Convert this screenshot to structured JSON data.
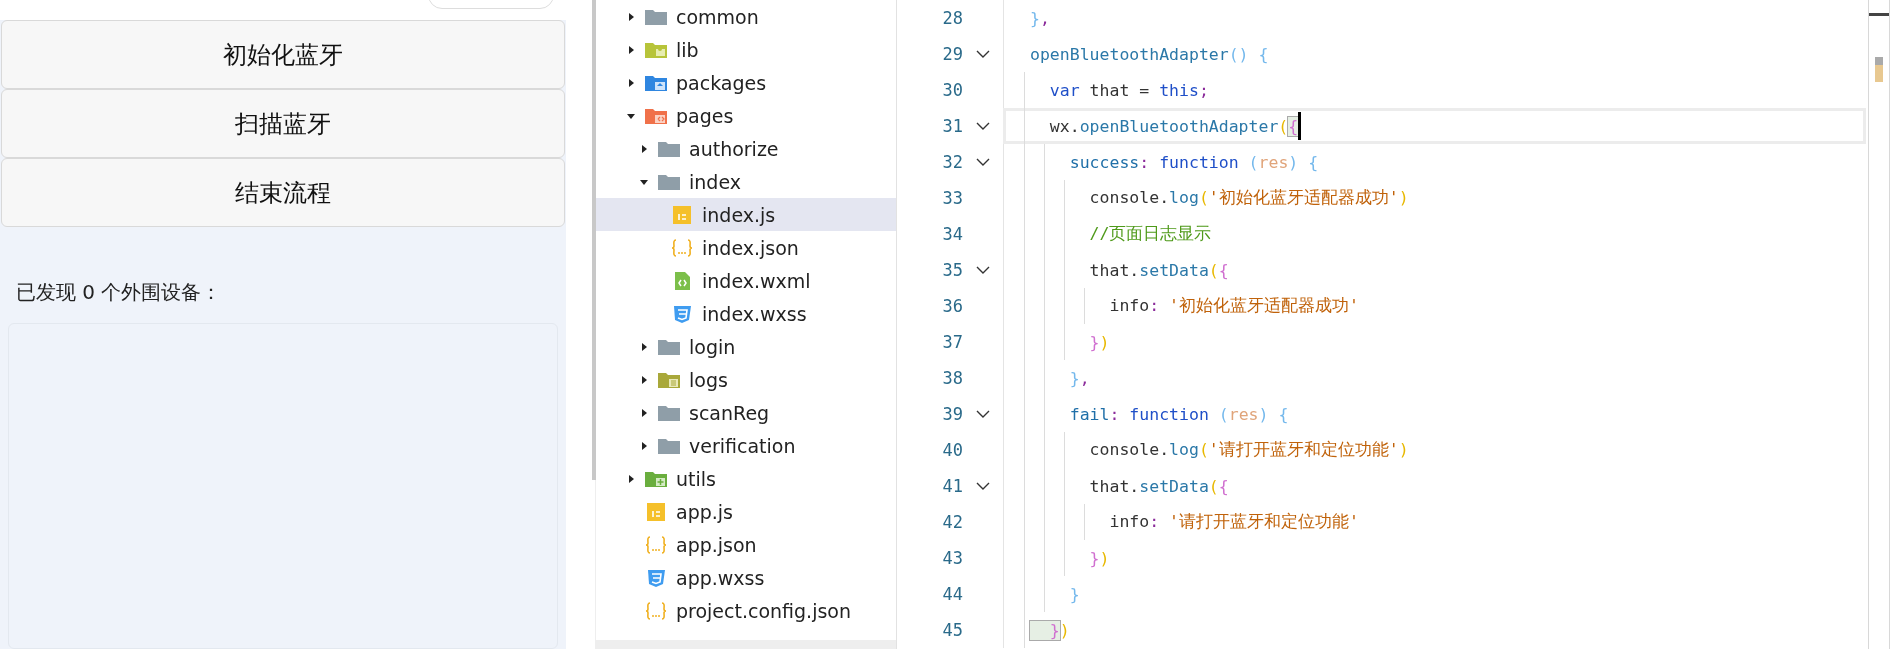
{
  "preview": {
    "buttons": [
      {
        "label": "初始化蓝牙"
      },
      {
        "label": "扫描蓝牙"
      },
      {
        "label": "结束流程"
      }
    ],
    "device_count_text": "已发现 0 个外围设备："
  },
  "file_tree": [
    {
      "label": "common",
      "kind": "folder",
      "expanded": false,
      "selected": false
    },
    {
      "label": "lib",
      "kind": "lib-folder",
      "expanded": false,
      "selected": false
    },
    {
      "label": "packages",
      "kind": "package-folder",
      "expanded": false,
      "selected": false
    },
    {
      "label": "pages",
      "kind": "pages-folder",
      "expanded": true,
      "selected": false,
      "children": [
        {
          "label": "authorize",
          "kind": "folder",
          "expanded": false,
          "selected": false
        },
        {
          "label": "index",
          "kind": "folder",
          "expanded": true,
          "selected": false,
          "children": [
            {
              "label": "index.js",
              "kind": "js-file",
              "selected": true
            },
            {
              "label": "index.json",
              "kind": "json-file",
              "selected": false
            },
            {
              "label": "index.wxml",
              "kind": "wxml-file",
              "selected": false
            },
            {
              "label": "index.wxss",
              "kind": "wxss-file",
              "selected": false
            }
          ]
        },
        {
          "label": "login",
          "kind": "folder",
          "expanded": false,
          "selected": false
        },
        {
          "label": "logs",
          "kind": "logs-folder",
          "expanded": false,
          "selected": false
        },
        {
          "label": "scanReg",
          "kind": "folder",
          "expanded": false,
          "selected": false
        },
        {
          "label": "verification",
          "kind": "folder",
          "expanded": false,
          "selected": false
        }
      ]
    },
    {
      "label": "utils",
      "kind": "utils-folder",
      "expanded": false,
      "selected": false
    },
    {
      "label": "app.js",
      "kind": "js-file",
      "selected": false
    },
    {
      "label": "app.json",
      "kind": "json-file",
      "selected": false
    },
    {
      "label": "app.wxss",
      "kind": "wxss-file",
      "selected": false
    },
    {
      "label": "project.config.json",
      "kind": "json-file",
      "selected": false
    }
  ],
  "editor": {
    "lines": [
      {
        "number": "28",
        "foldable": false,
        "current": false,
        "tokens": [
          {
            "text": "}",
            "kind": "bracket3",
            "matched": false
          },
          {
            "text": ",",
            "kind": "punct",
            "matched": false
          }
        ]
      },
      {
        "number": "29",
        "foldable": true,
        "current": false,
        "tokens": [
          {
            "text": "openBluetoothAdapter",
            "kind": "method",
            "matched": false
          },
          {
            "text": "() {",
            "kind": "bracket3",
            "matched": false
          }
        ]
      },
      {
        "number": "30",
        "foldable": false,
        "current": false,
        "tokens": [
          {
            "text": "  var",
            "kind": "keyword",
            "matched": false
          },
          {
            "text": " that = ",
            "kind": "plain",
            "matched": false
          },
          {
            "text": "this",
            "kind": "keyword",
            "matched": false
          },
          {
            "text": ";",
            "kind": "punct",
            "matched": false
          }
        ]
      },
      {
        "number": "31",
        "foldable": true,
        "current": true,
        "tokens": [
          {
            "text": "  wx.",
            "kind": "plain",
            "matched": false
          },
          {
            "text": "openBluetoothAdapter",
            "kind": "method",
            "matched": false
          },
          {
            "text": "(",
            "kind": "bracket1",
            "matched": false
          },
          {
            "text": "{",
            "kind": "bracket2",
            "matched": true
          }
        ]
      },
      {
        "number": "32",
        "foldable": true,
        "current": false,
        "tokens": [
          {
            "text": "    success",
            "kind": "prop",
            "matched": false
          },
          {
            "text": ": ",
            "kind": "punct",
            "matched": false
          },
          {
            "text": "function",
            "kind": "keyword",
            "matched": false
          },
          {
            "text": " (",
            "kind": "bracket3",
            "matched": false
          },
          {
            "text": "res",
            "kind": "param",
            "matched": false
          },
          {
            "text": ") {",
            "kind": "bracket3",
            "matched": false
          }
        ]
      },
      {
        "number": "33",
        "foldable": false,
        "current": false,
        "tokens": [
          {
            "text": "      console.",
            "kind": "plain",
            "matched": false
          },
          {
            "text": "log",
            "kind": "method",
            "matched": false
          },
          {
            "text": "(",
            "kind": "bracket1",
            "matched": false
          },
          {
            "text": "'初始化蓝牙适配器成功'",
            "kind": "string",
            "matched": false
          },
          {
            "text": ")",
            "kind": "bracket1",
            "matched": false
          }
        ]
      },
      {
        "number": "34",
        "foldable": false,
        "current": false,
        "tokens": [
          {
            "text": "      //页面日志显示",
            "kind": "comment",
            "matched": false
          }
        ]
      },
      {
        "number": "35",
        "foldable": true,
        "current": false,
        "tokens": [
          {
            "text": "      that.",
            "kind": "plain",
            "matched": false
          },
          {
            "text": "setData",
            "kind": "method",
            "matched": false
          },
          {
            "text": "(",
            "kind": "bracket1",
            "matched": false
          },
          {
            "text": "{",
            "kind": "bracket2",
            "matched": false
          }
        ]
      },
      {
        "number": "36",
        "foldable": false,
        "current": false,
        "tokens": [
          {
            "text": "        info",
            "kind": "plain",
            "matched": false
          },
          {
            "text": ": ",
            "kind": "punct",
            "matched": false
          },
          {
            "text": "'初始化蓝牙适配器成功'",
            "kind": "string",
            "matched": false
          }
        ]
      },
      {
        "number": "37",
        "foldable": false,
        "current": false,
        "tokens": [
          {
            "text": "      }",
            "kind": "bracket2",
            "matched": false
          },
          {
            "text": ")",
            "kind": "bracket1",
            "matched": false
          }
        ]
      },
      {
        "number": "38",
        "foldable": false,
        "current": false,
        "tokens": [
          {
            "text": "    }",
            "kind": "bracket3",
            "matched": false
          },
          {
            "text": ",",
            "kind": "punct",
            "matched": false
          }
        ]
      },
      {
        "number": "39",
        "foldable": true,
        "current": false,
        "tokens": [
          {
            "text": "    fail",
            "kind": "prop",
            "matched": false
          },
          {
            "text": ": ",
            "kind": "punct",
            "matched": false
          },
          {
            "text": "function",
            "kind": "keyword",
            "matched": false
          },
          {
            "text": " (",
            "kind": "bracket3",
            "matched": false
          },
          {
            "text": "res",
            "kind": "param",
            "matched": false
          },
          {
            "text": ") {",
            "kind": "bracket3",
            "matched": false
          }
        ]
      },
      {
        "number": "40",
        "foldable": false,
        "current": false,
        "tokens": [
          {
            "text": "      console.",
            "kind": "plain",
            "matched": false
          },
          {
            "text": "log",
            "kind": "method",
            "matched": false
          },
          {
            "text": "(",
            "kind": "bracket1",
            "matched": false
          },
          {
            "text": "'请打开蓝牙和定位功能'",
            "kind": "string",
            "matched": false
          },
          {
            "text": ")",
            "kind": "bracket1",
            "matched": false
          }
        ]
      },
      {
        "number": "41",
        "foldable": true,
        "current": false,
        "tokens": [
          {
            "text": "      that.",
            "kind": "plain",
            "matched": false
          },
          {
            "text": "setData",
            "kind": "method",
            "matched": false
          },
          {
            "text": "(",
            "kind": "bracket1",
            "matched": false
          },
          {
            "text": "{",
            "kind": "bracket2",
            "matched": false
          }
        ]
      },
      {
        "number": "42",
        "foldable": false,
        "current": false,
        "tokens": [
          {
            "text": "        info",
            "kind": "plain",
            "matched": false
          },
          {
            "text": ": ",
            "kind": "punct",
            "matched": false
          },
          {
            "text": "'请打开蓝牙和定位功能'",
            "kind": "string",
            "matched": false
          }
        ]
      },
      {
        "number": "43",
        "foldable": false,
        "current": false,
        "tokens": [
          {
            "text": "      }",
            "kind": "bracket2",
            "matched": false
          },
          {
            "text": ")",
            "kind": "bracket1",
            "matched": false
          }
        ]
      },
      {
        "number": "44",
        "foldable": false,
        "current": false,
        "tokens": [
          {
            "text": "    }",
            "kind": "bracket3",
            "matched": false
          }
        ]
      },
      {
        "number": "45",
        "foldable": false,
        "current": false,
        "tokens": [
          {
            "text": "  }",
            "kind": "bracket2",
            "matched": true
          },
          {
            "text": ")",
            "kind": "bracket1",
            "matched": false
          }
        ]
      }
    ]
  }
}
